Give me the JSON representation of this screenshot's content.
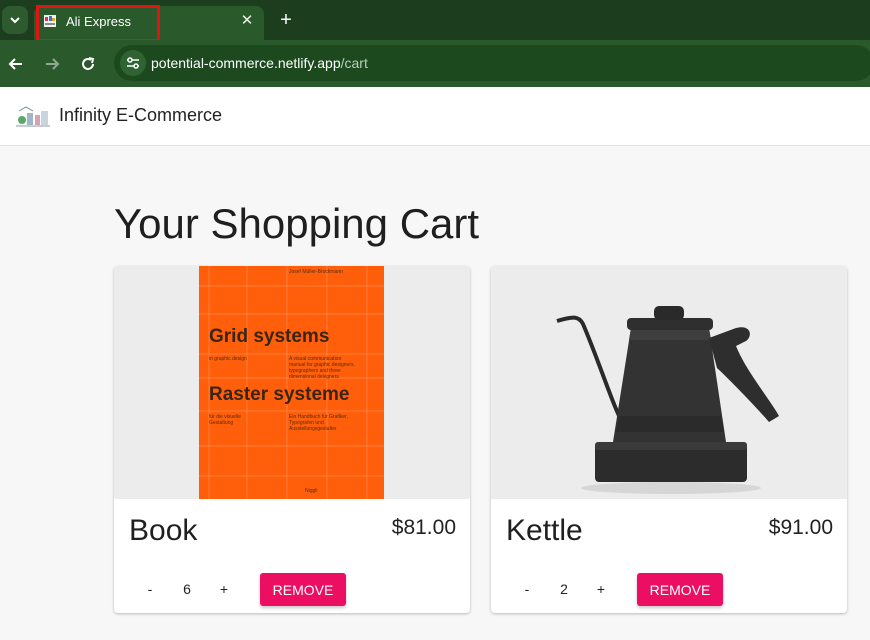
{
  "browser": {
    "tab_title": "Ali Express",
    "close_glyph": "✕",
    "new_tab_glyph": "+",
    "tab_menu_glyph": "⌄",
    "url_host": "potential-commerce.netlify.app",
    "url_path": "/cart",
    "icons": [
      "chevron-down-icon",
      "favicon-icon",
      "close-icon",
      "plus-icon",
      "back-icon",
      "forward-icon",
      "reload-icon",
      "site-info-icon"
    ]
  },
  "app": {
    "brand": "Infinity E-Commerce"
  },
  "cart": {
    "title": "Your Shopping Cart",
    "items": [
      {
        "name": "Book",
        "price": "$81.00",
        "quantity": "6",
        "minus": "-",
        "plus": "+",
        "remove_label": "REMOVE",
        "cover": {
          "author": "Josef Müller-Brockmann",
          "title_en": "Grid systems",
          "subtitle_en": "in graphic design",
          "title_de": "Raster systeme",
          "subtitle_de": "für die visuelle Gestaltung",
          "desc_en": "A visual communication manual for graphic designers, typographers and three dimensional designers",
          "desc_de": "Ein Handbuch für Grafiker, Typografen und Ausstellungsgestalter",
          "publisher": "Niggli"
        }
      },
      {
        "name": "Kettle",
        "price": "$91.00",
        "quantity": "2",
        "minus": "-",
        "plus": "+",
        "remove_label": "REMOVE"
      }
    ]
  },
  "colors": {
    "chrome_dark": "#1c3d1e",
    "chrome": "#2a5a2c",
    "accent": "#ec0e63",
    "book_orange": "#ff5e0a",
    "highlight": "#e31313"
  }
}
